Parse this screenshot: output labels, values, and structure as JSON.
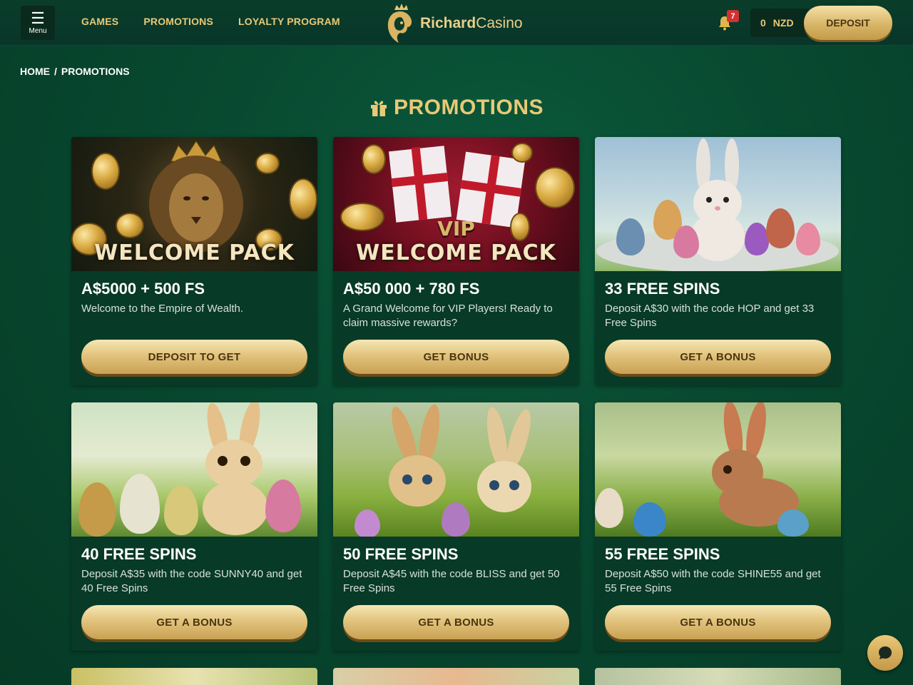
{
  "header": {
    "menu_label": "Menu",
    "nav": [
      "GAMES",
      "PROMOTIONS",
      "LOYALTY PROGRAM"
    ],
    "logo_bold": "Richard",
    "logo_thin": "Casino",
    "notification_count": "7",
    "balance_amount": "0",
    "balance_currency": "NZD",
    "deposit_label": "DEPOSIT"
  },
  "breadcrumb": {
    "home": "HOME",
    "separator": "/",
    "current": "PROMOTIONS"
  },
  "page_title": "PROMOTIONS",
  "cards": [
    {
      "banner": "WELCOME PACK",
      "title": "A$5000 + 500 FS",
      "desc": "Welcome to the Empire of Wealth.",
      "button": "DEPOSIT TO GET"
    },
    {
      "vip": "VIP",
      "banner": "WELCOME PACK",
      "title": "A$50 000 + 780 FS",
      "desc": "A Grand Welcome for VIP Players! Ready to claim massive rewards?",
      "button": "GET BONUS"
    },
    {
      "title": "33 FREE SPINS",
      "desc": "Deposit A$30 with the code HOP and get 33 Free Spins",
      "button": "GET A BONUS"
    },
    {
      "title": "40 FREE SPINS",
      "desc": "Deposit A$35 with the code SUNNY40 and get 40 Free Spins",
      "button": "GET A BONUS"
    },
    {
      "title": "50 FREE SPINS",
      "desc": "Deposit A$45 with the code BLISS and get 50 Free Spins",
      "button": "GET A BONUS"
    },
    {
      "title": "55 FREE SPINS",
      "desc": "Deposit A$50 with the code SHINE55 and get 55 Free Spins",
      "button": "GET A BONUS"
    }
  ],
  "colors": {
    "accent_gold": "#e8c977",
    "background": "#084a31",
    "card_bg": "#073a27",
    "badge_red": "#d43030"
  },
  "icons": [
    "menu-icon",
    "crowned-lion-logo-icon",
    "bell-icon",
    "gift-icon",
    "chat-icon"
  ]
}
